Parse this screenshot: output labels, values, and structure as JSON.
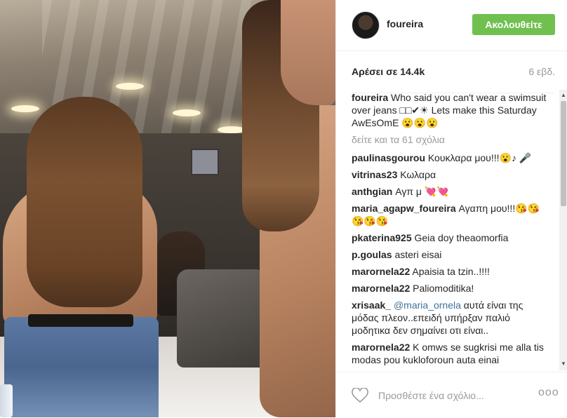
{
  "header": {
    "username": "foureira",
    "follow_label": "Ακολουθείτε"
  },
  "meta": {
    "likes": "Αρέσει σε 14.4k",
    "age": "6 εβδ."
  },
  "caption": {
    "user": "foureira",
    "text": "Who said you can't wear a swimsuit over jeans □□✔☀ Lets make this Saturday AwEsOmE 😮😮😮"
  },
  "view_all": "δείτε και τα 61 σχόλια",
  "comments": [
    {
      "user": "paulinasgourou",
      "text": "Κουκλαρα μου!!!😮♪ 🎤"
    },
    {
      "user": "vitrinas23",
      "text": "Κωλαρα"
    },
    {
      "user": "anthgian",
      "text": "Αγπ μ 💘💘"
    },
    {
      "user": "maria_agapw_foureira",
      "text": "Αγαπη μου!!!😘😘😘😘😘"
    },
    {
      "user": "pkaterina925",
      "text": "Geia doy theaomorfia"
    },
    {
      "user": "p.goulas",
      "text": "asteri eisai"
    },
    {
      "user": "marornela22",
      "text": "Apaisia ta tzin..!!!!"
    },
    {
      "user": "marornela22",
      "text": "Paliomoditika!"
    },
    {
      "user": "xrisaak_",
      "mention": "@maria_ornela",
      "text": "αυτά είναι της μόδας πλεον..επειδή υπήρξαν παλιό μοδητικα δεν σημαίνει οτι είναι.."
    },
    {
      "user": "marornela22",
      "text": "K omws se sugkrisi me alla tis modas pou kukloforoun auta einai"
    }
  ],
  "footer": {
    "comment_placeholder": "Προσθέστε ένα σχόλιο...",
    "more_label": "ooo"
  },
  "icons": {
    "heart": "heart-icon",
    "more": "more-options-icon"
  }
}
